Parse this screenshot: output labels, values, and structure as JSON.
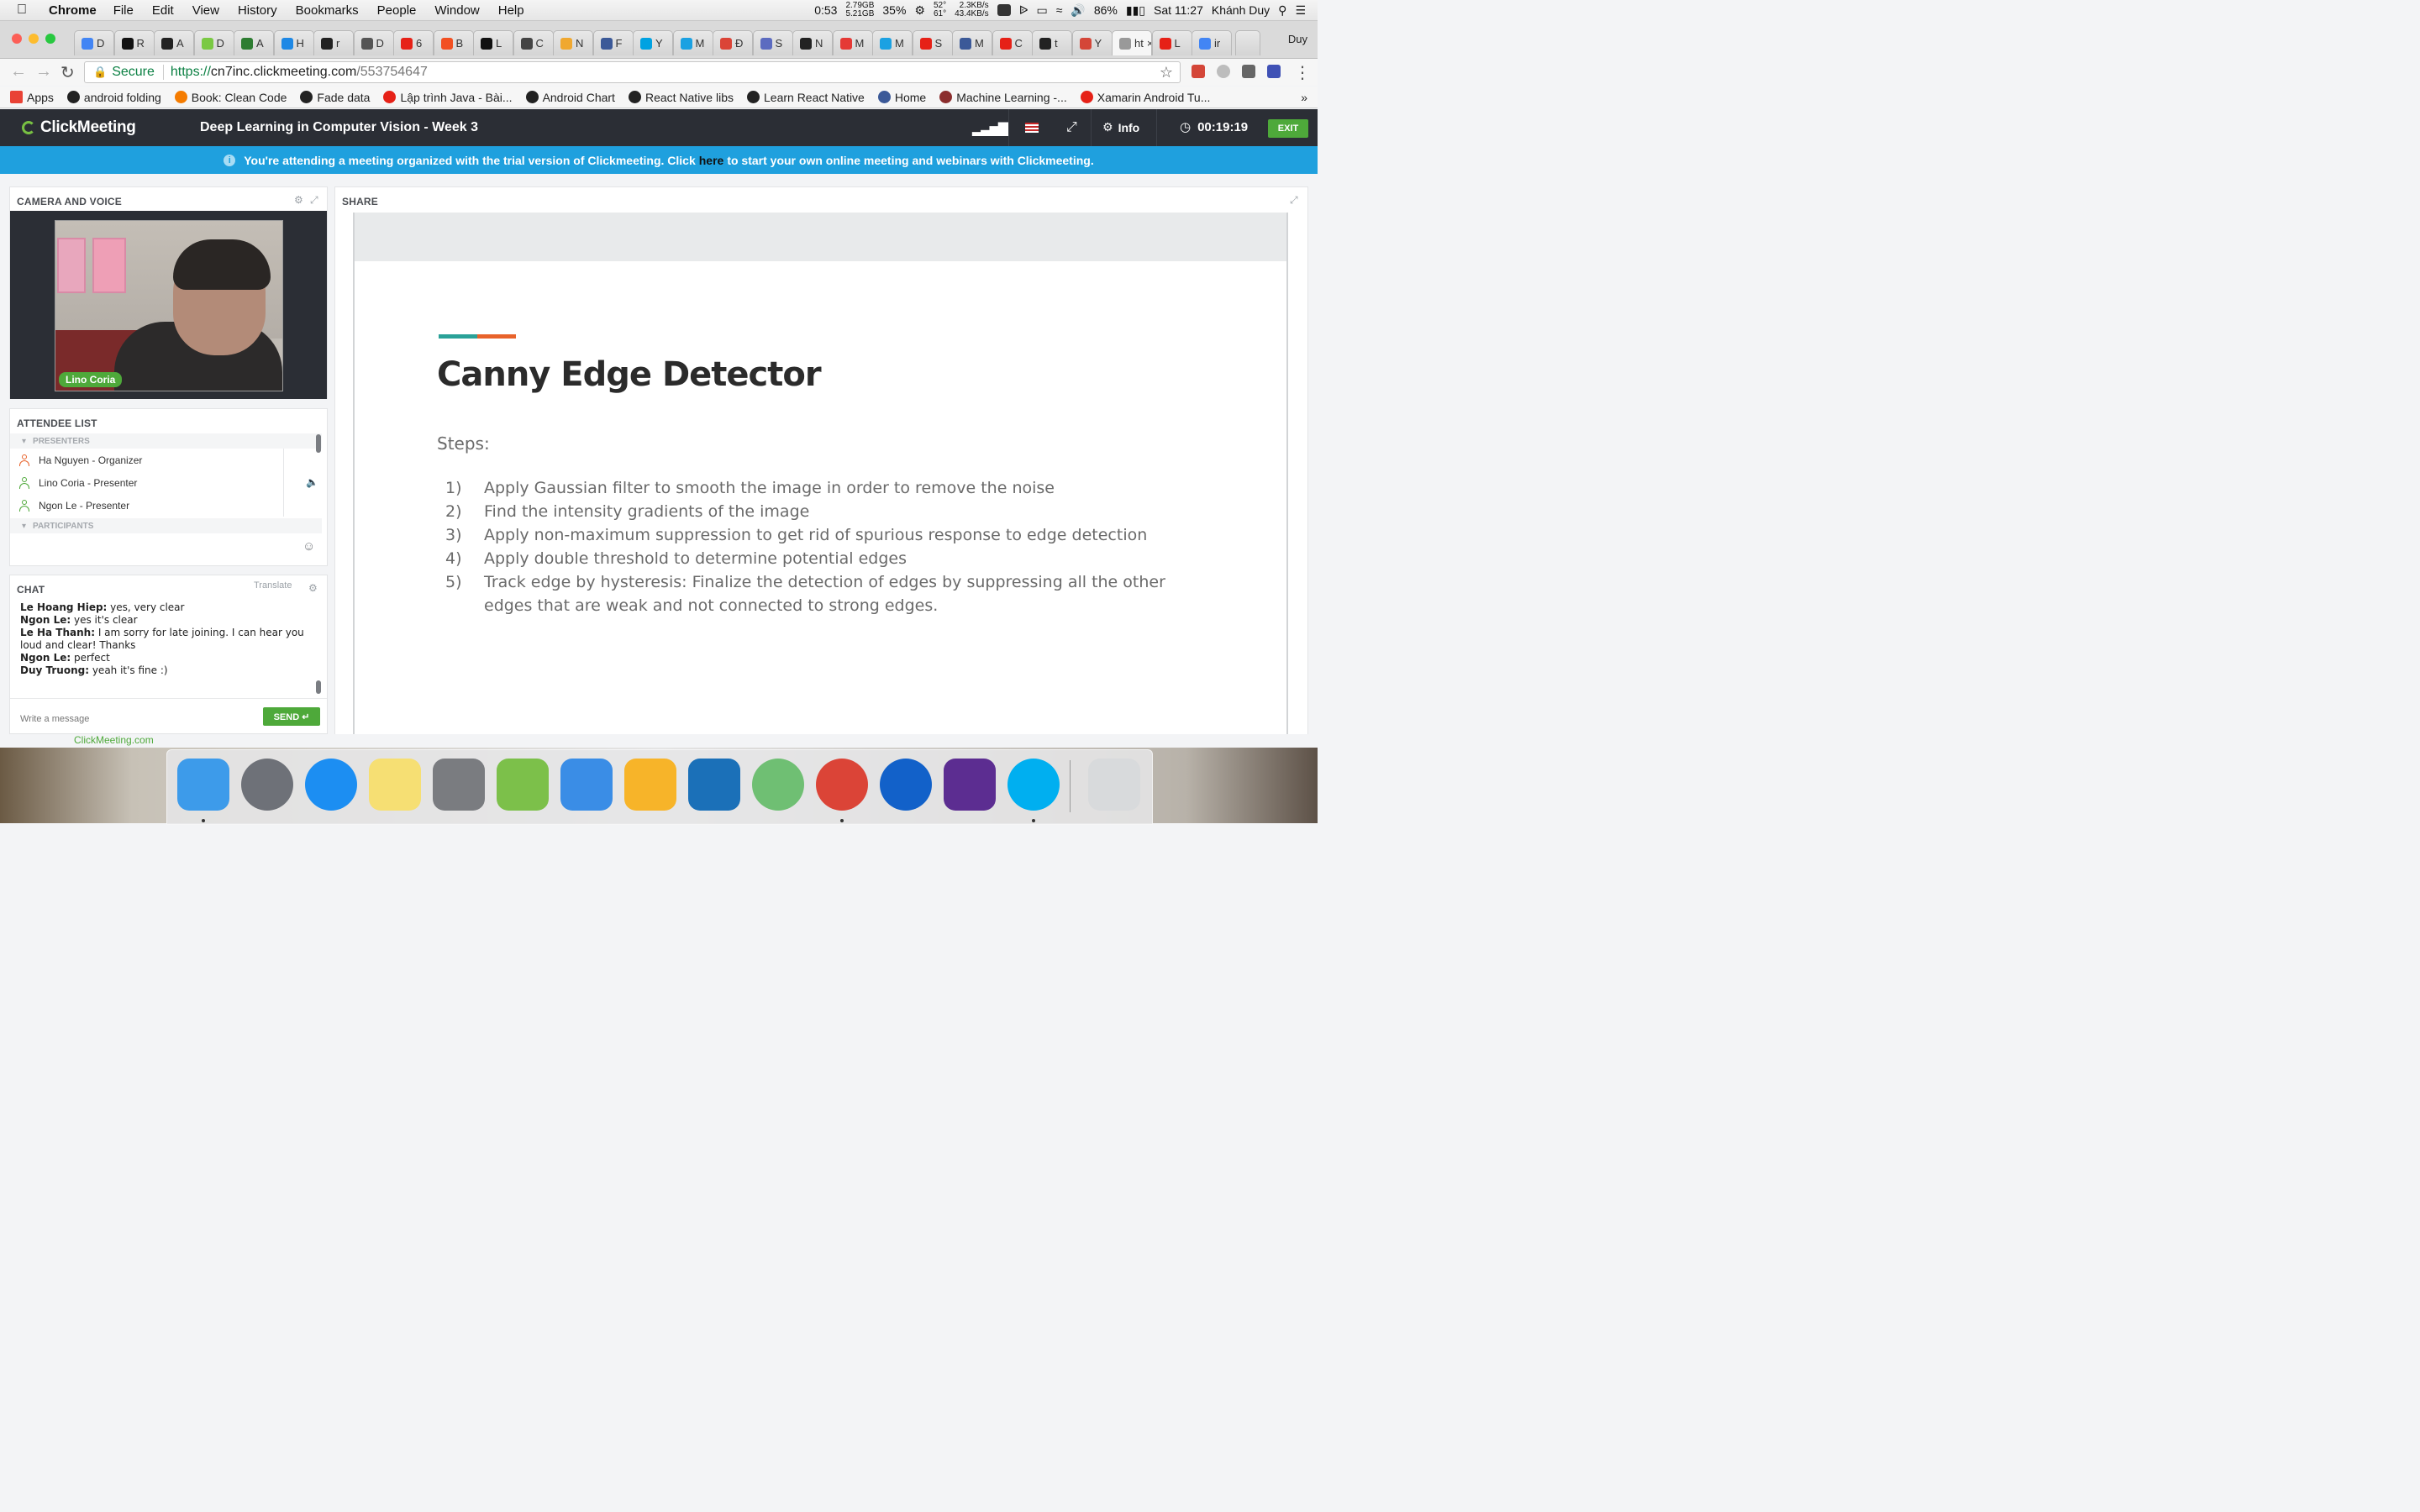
{
  "menubar": {
    "app": "Chrome",
    "menus": [
      "File",
      "Edit",
      "View",
      "History",
      "Bookmarks",
      "People",
      "Window",
      "Help"
    ],
    "battery_time": "0:53",
    "memory_used": "2.79GB",
    "memory_free": "5.21GB",
    "cpu": "35%",
    "temp_top": "52°",
    "temp_bottom": "61°",
    "net_up": "2.3KB/s",
    "net_down": "43.4KB/s",
    "battery": "86%",
    "clock": "Sat 11:27",
    "user": "Khánh Duy"
  },
  "browser": {
    "profile": "Duy",
    "active_tab_label": "ht",
    "tabs": [
      "D",
      "R",
      "A",
      "D",
      "A",
      "H",
      "r",
      "D",
      "6",
      "B",
      "L",
      "C",
      "N",
      "F",
      "Y",
      "M",
      "Đ",
      "S",
      "N",
      "M",
      "M",
      "S",
      "M",
      "C",
      "t",
      "Y",
      "ht",
      "L",
      "ir"
    ],
    "tab_colors": [
      "#4285f4",
      "#111111",
      "#222222",
      "#7ac943",
      "#2e7d32",
      "#1e88e5",
      "#222222",
      "#555555",
      "#e62117",
      "#f25022",
      "#111111",
      "#444444",
      "#f0a830",
      "#3b5998",
      "#00a2e2",
      "#1ba1e2",
      "#db4437",
      "#5c6bc0",
      "#222222",
      "#e53935",
      "#1ba1e2",
      "#e62117",
      "#3b5998",
      "#e62117",
      "#222222",
      "#d44638",
      "#999999",
      "#e62117",
      "#4285f4"
    ],
    "secure_label": "Secure",
    "url_scheme": "https://",
    "url_host": "cn7inc.clickmeeting.com",
    "url_path": "/553754647",
    "bookmarks": [
      {
        "label": "Apps",
        "color": "#e94235"
      },
      {
        "label": "android folding",
        "color": "#222222"
      },
      {
        "label": "Book: Clean Code",
        "color": "#f57c00"
      },
      {
        "label": "Fade data",
        "color": "#222222"
      },
      {
        "label": "Lập trình Java - Bài...",
        "color": "#e62117"
      },
      {
        "label": "Android Chart",
        "color": "#222222"
      },
      {
        "label": "React Native libs",
        "color": "#222222"
      },
      {
        "label": "Learn React Native",
        "color": "#222222"
      },
      {
        "label": "Home",
        "color": "#3b5998"
      },
      {
        "label": "Machine Learning -...",
        "color": "#8b2d2d"
      },
      {
        "label": "Xamarin Android Tu...",
        "color": "#e62117"
      }
    ]
  },
  "meeting": {
    "logo": "ClickMeeting",
    "title": "Deep Learning in Computer Vision - Week 3",
    "info_label": "Info",
    "timer": "00:19:19",
    "exit_label": "EXIT",
    "banner_pre": "You're attending a meeting organized with the trial version of Clickmeeting. Click",
    "banner_link": "here",
    "banner_post": "to start your own online meeting and webinars with Clickmeeting."
  },
  "camera": {
    "title": "CAMERA AND VOICE",
    "speaker_name": "Lino Coria"
  },
  "attendees": {
    "title": "ATTENDEE LIST",
    "presenters_label": "PRESENTERS",
    "participants_label": "PARTICIPANTS",
    "presenters": [
      {
        "name": "Ha Nguyen  - Organizer",
        "color": "#e8632b"
      },
      {
        "name": "Lino Coria  - Presenter",
        "color": "#4ea93a"
      },
      {
        "name": "Ngon Le  - Presenter",
        "color": "#4ea93a"
      }
    ]
  },
  "chat": {
    "title": "CHAT",
    "translate": "Translate",
    "messages": [
      {
        "author": "Le Hoang Hiep:",
        "text": " yes, very clear"
      },
      {
        "author": "Ngon Le:",
        "text": " yes it's clear"
      },
      {
        "author": "Le Ha Thanh:",
        "text": " I am sorry for late joining. I can hear you loud and clear! Thanks"
      },
      {
        "author": "Ngon Le:",
        "text": " perfect"
      },
      {
        "author": "Duy Truong:",
        "text": " yeah it's fine :)"
      }
    ],
    "input_placeholder": "Write a message",
    "send_label": "SEND"
  },
  "share": {
    "title": "SHARE",
    "slide_title": "Canny Edge Detector",
    "slide_subtitle": "Steps:",
    "steps": [
      {
        "num": "1)",
        "text": "Apply Gaussian filter to smooth the image in order to remove the noise"
      },
      {
        "num": "2)",
        "text": "Find the intensity gradients of the image"
      },
      {
        "num": "3)",
        "text": "Apply non-maximum suppression to get rid of spurious response to edge detection"
      },
      {
        "num": "4)",
        "text": "Apply double threshold to determine potential edges"
      },
      {
        "num": "5)",
        "text": "Track edge by hysteresis: Finalize the detection of edges by suppressing all the other edges that are weak and not connected to strong edges."
      }
    ]
  },
  "footer": {
    "link": "ClickMeeting.com"
  },
  "dock": [
    {
      "name": "finder-icon",
      "color": "#3d9bea",
      "running": true
    },
    {
      "name": "launchpad-icon",
      "color": "#6e7178",
      "running": false
    },
    {
      "name": "itunes-icon",
      "color": "#1c8ef2",
      "running": false
    },
    {
      "name": "notes-icon",
      "color": "#f6df73",
      "running": false
    },
    {
      "name": "system-preferences-icon",
      "color": "#7a7c80",
      "running": false
    },
    {
      "name": "android-studio-icon",
      "color": "#7cc04a",
      "running": false
    },
    {
      "name": "xcode-icon",
      "color": "#3a8de6",
      "running": false
    },
    {
      "name": "sketch-icon",
      "color": "#f7b429",
      "running": false
    },
    {
      "name": "vmware-icon",
      "color": "#1b70b8",
      "running": false
    },
    {
      "name": "atom-icon",
      "color": "#6fbf73",
      "running": false
    },
    {
      "name": "chrome-icon",
      "color": "#db4437",
      "running": true
    },
    {
      "name": "sourcetree-icon",
      "color": "#1261c9",
      "running": false
    },
    {
      "name": "visual-studio-icon",
      "color": "#5c2d91",
      "running": false
    },
    {
      "name": "skype-icon",
      "color": "#00aff0",
      "running": true
    },
    {
      "name": "trash-icon",
      "color": "#d8dadc",
      "running": false
    }
  ]
}
